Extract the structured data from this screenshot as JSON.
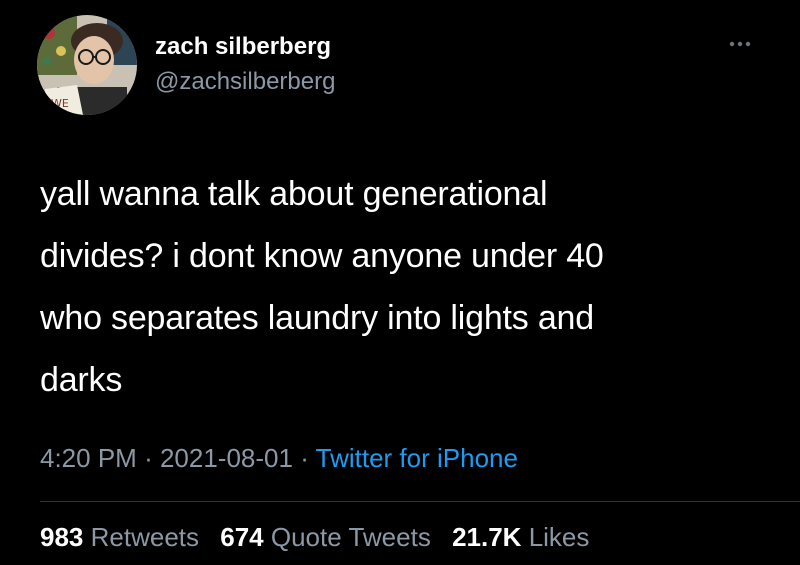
{
  "colors": {
    "background": "#000000",
    "primary_text": "#ffffff",
    "secondary_text": "#8b98a5",
    "link": "#1d9bf0",
    "divider": "#2f3336"
  },
  "author": {
    "display_name": "zach silberberg",
    "handle": "@zachsilberberg",
    "avatar_icon": "profile-photo"
  },
  "more_menu": {
    "icon": "more-dots-icon"
  },
  "tweet": {
    "lines": [
      "yall wanna talk about generational",
      "divides? i dont know anyone under 40",
      "who separates laundry into lights and",
      "darks"
    ]
  },
  "meta": {
    "time": "4:20 PM",
    "separator": "·",
    "date": "2021-08-01",
    "source": "Twitter for iPhone"
  },
  "stats": {
    "retweets_count": "983",
    "retweets_label": "Retweets",
    "quote_count": "674",
    "quote_label": "Quote Tweets",
    "likes_count": "21.7K",
    "likes_label": "Likes"
  }
}
